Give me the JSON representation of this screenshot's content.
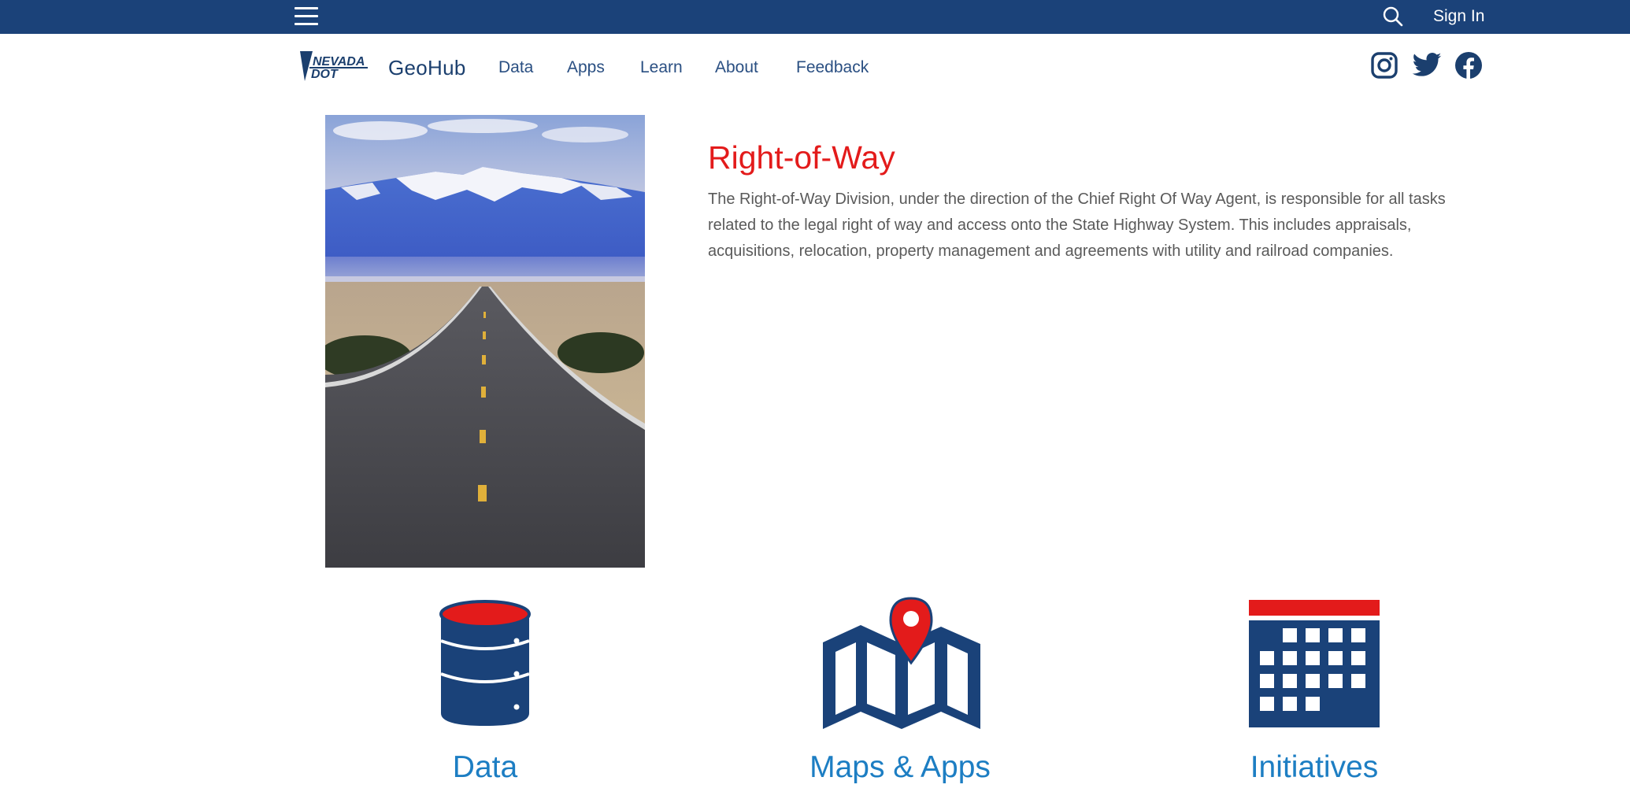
{
  "topbar": {
    "menu_icon": "hamburger-menu-icon",
    "search_icon": "search-icon",
    "signin_label": "Sign In"
  },
  "nav": {
    "logo_text_line1": "NEVADA",
    "logo_text_line2": "DOT",
    "brand": "GeoHub",
    "links": [
      {
        "label": "Data"
      },
      {
        "label": "Apps"
      },
      {
        "label": "Learn"
      },
      {
        "label": "About"
      },
      {
        "label": "Feedback"
      }
    ],
    "social": [
      "instagram-icon",
      "twitter-icon",
      "facebook-icon"
    ]
  },
  "content": {
    "title": "Right-of-Way",
    "description": "The Right-of-Way Division, under the direction of the Chief Right Of Way Agent, is responsible for all tasks related to the legal right of way and access onto the State Highway System. This includes appraisals, acquisitions, relocation, property management and agreements with utility and railroad companies."
  },
  "tiles": [
    {
      "label": "Data",
      "icon": "database-icon"
    },
    {
      "label": "Maps & Apps",
      "icon": "map-pin-icon"
    },
    {
      "label": "Initiatives",
      "icon": "calendar-icon"
    }
  ],
  "colors": {
    "topbar": "#1b4279",
    "navy": "#1b3f6e",
    "accent_red": "#e31b1b",
    "tile_label": "#1d7ec3",
    "icon_navy": "#1a4279"
  }
}
